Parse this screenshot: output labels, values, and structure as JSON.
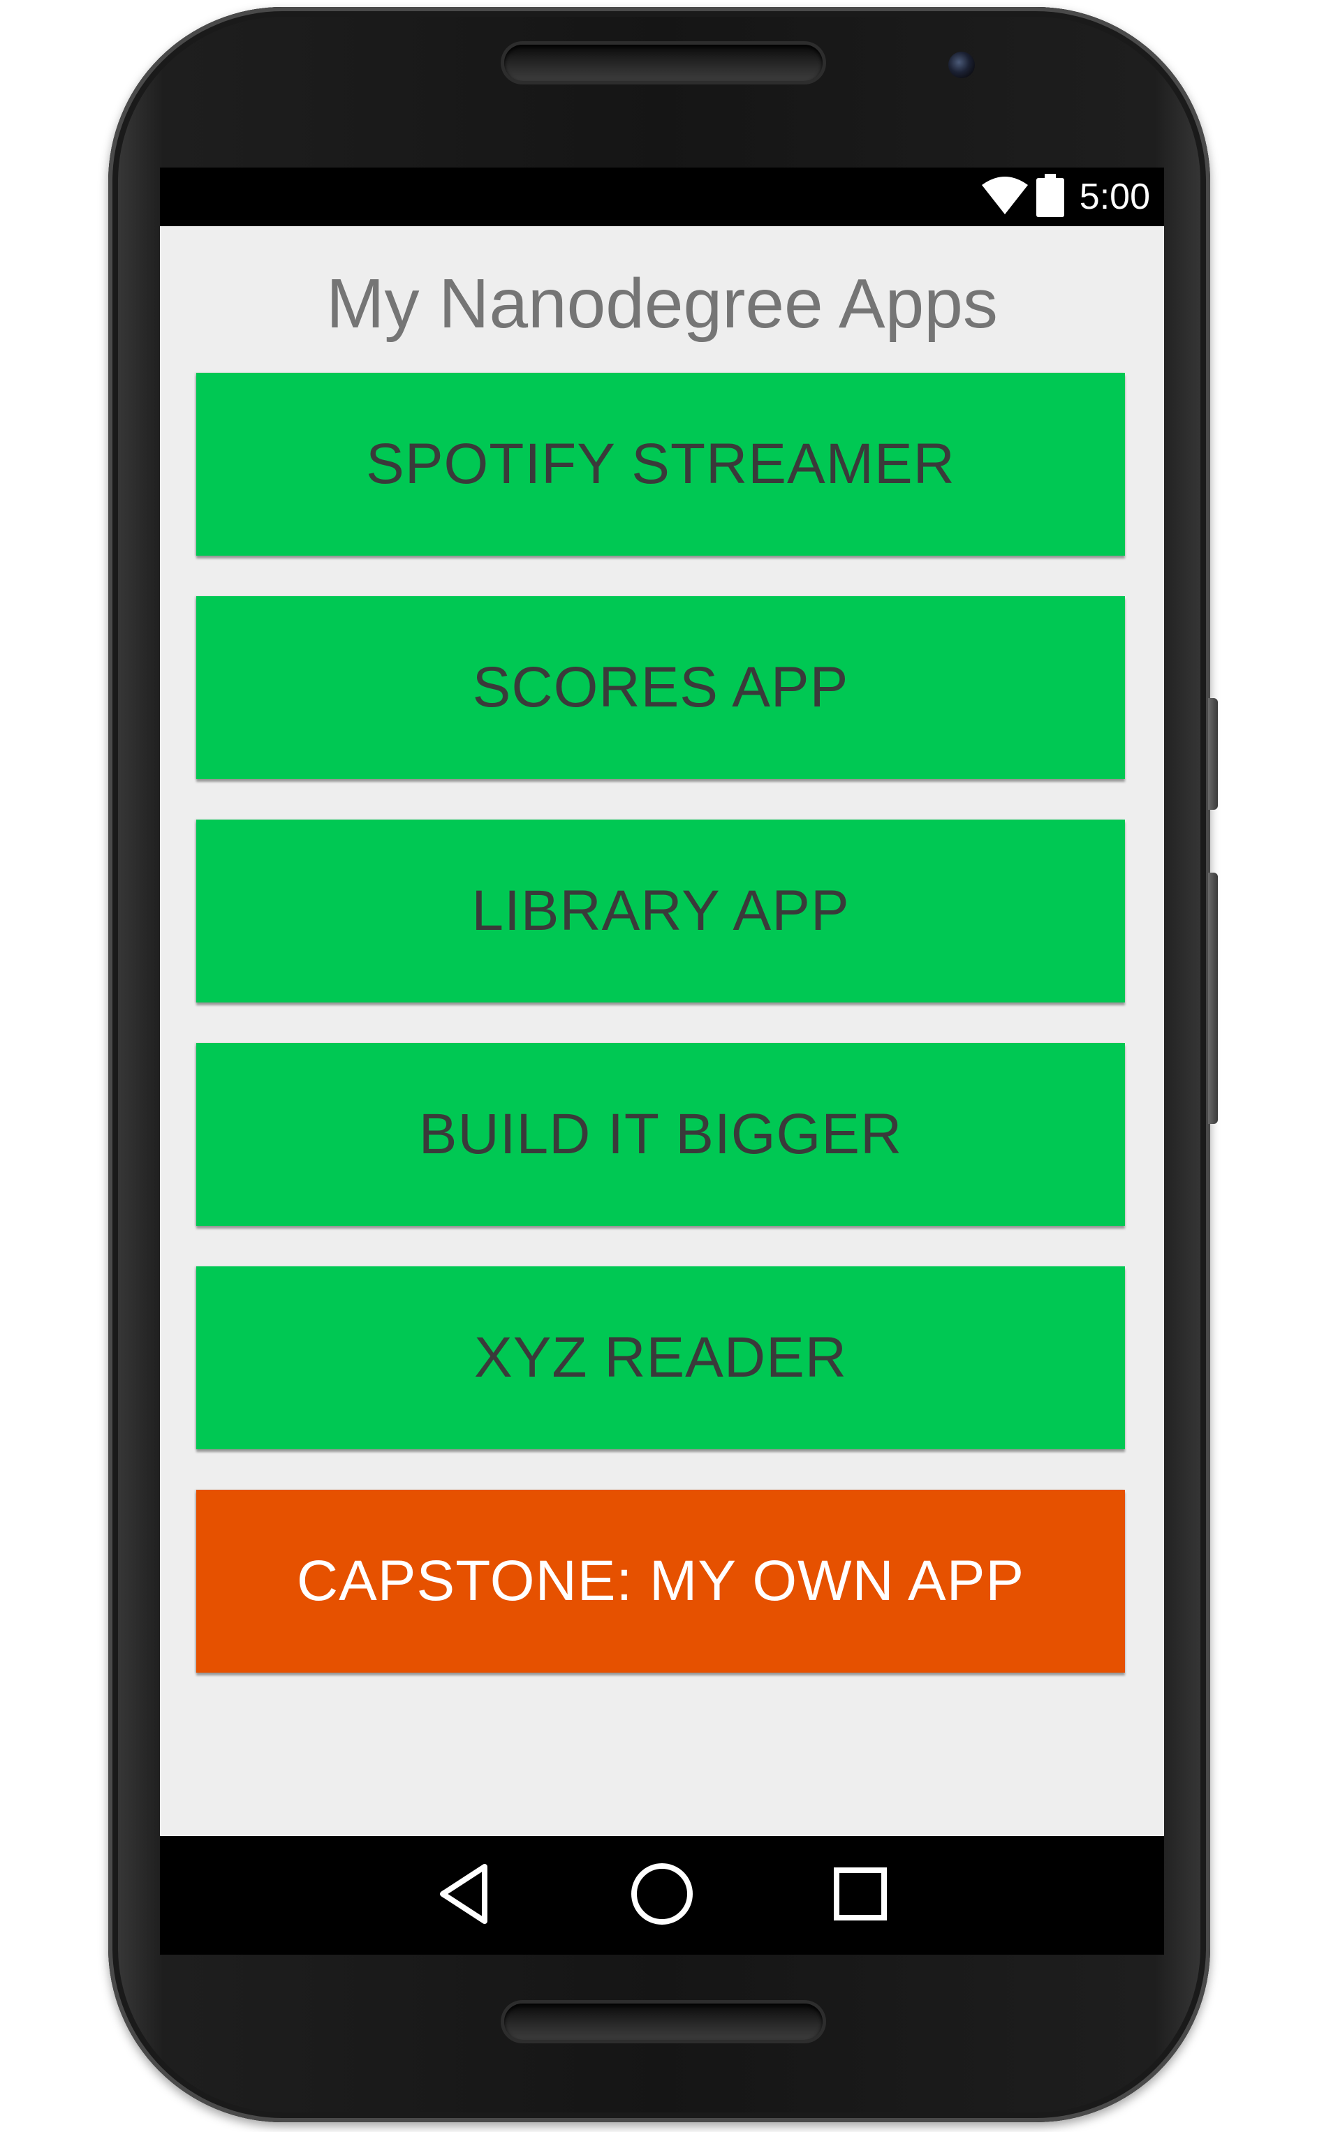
{
  "status_bar": {
    "time": "5:00",
    "icons": [
      "wifi-icon",
      "battery-icon"
    ]
  },
  "app": {
    "title": "My Nanodegree Apps",
    "buttons": [
      {
        "label": "SPOTIFY STREAMER",
        "color": "#00c853"
      },
      {
        "label": "SCORES APP",
        "color": "#00c853"
      },
      {
        "label": "LIBRARY APP",
        "color": "#00c853"
      },
      {
        "label": "BUILD IT BIGGER",
        "color": "#00c853"
      },
      {
        "label": "XYZ READER",
        "color": "#00c853"
      },
      {
        "label": "CAPSTONE: MY OWN APP",
        "color": "#e65100"
      }
    ]
  },
  "nav_bar": {
    "buttons": [
      "back-icon",
      "home-icon",
      "recents-icon"
    ]
  },
  "colors": {
    "background": "#eeeeee",
    "title_text": "#757575",
    "green_accent": "#00c853",
    "orange_accent": "#e65100"
  }
}
